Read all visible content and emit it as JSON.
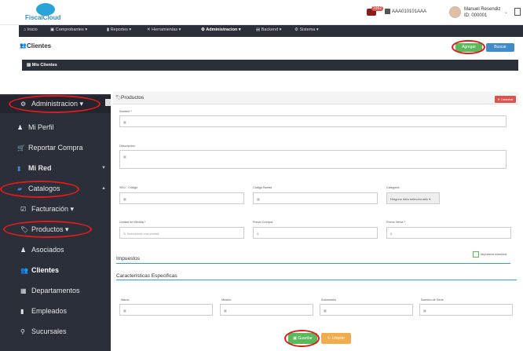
{
  "header": {
    "logo_text": "FiscalCloud",
    "notification_count": "1992",
    "company": "AAA010101AAA",
    "user_name": "Manuel Resendiz",
    "user_id": "ID: 000001"
  },
  "navbar": {
    "items": [
      {
        "label": "Inicio",
        "icon": "home-icon"
      },
      {
        "label": "Comprobantes",
        "icon": "file-icon"
      },
      {
        "label": "Reportes",
        "icon": "bar-chart-icon"
      },
      {
        "label": "Herramientas",
        "icon": "tools-icon"
      },
      {
        "label": "Administracion",
        "icon": "gears-icon",
        "active": true
      },
      {
        "label": "Backend",
        "icon": "server-icon"
      },
      {
        "label": "Sistema",
        "icon": "cog-icon"
      }
    ]
  },
  "clientes": {
    "title": "Clientes",
    "agregar_label": "Agregar",
    "buscar_label": "Buscar",
    "mis_clientes": "Mis Clientes"
  },
  "sidebar": {
    "items": [
      {
        "label": "Administracion",
        "icon": "gears-icon"
      },
      {
        "label": "Mi Perfil",
        "icon": "user-icon"
      },
      {
        "label": "Reportar Compra",
        "icon": "cart-icon"
      },
      {
        "label": "Mi Red",
        "icon": "network-icon"
      },
      {
        "label": "Catalogos",
        "icon": "book-icon"
      },
      {
        "label": "Facturación",
        "icon": "invoice-icon"
      },
      {
        "label": "Productos",
        "icon": "tag-icon"
      },
      {
        "label": "Asociados",
        "icon": "user-icon"
      },
      {
        "label": "Clientes",
        "icon": "users-icon"
      },
      {
        "label": "Departamentos",
        "icon": "building-icon"
      },
      {
        "label": "Empleados",
        "icon": "employee-icon"
      },
      {
        "label": "Sucursales",
        "icon": "location-icon"
      }
    ]
  },
  "productos": {
    "title": "Productos",
    "cancelar_label": "Cancelar",
    "fields": {
      "nombre": "Nombre *",
      "descripcion": "Descripción",
      "sku": "SKU - Código",
      "codigo_barras": "Código Barras",
      "categoria": "Categoria",
      "categoria_value": "Ninguno dato seleccionado",
      "unidad": "Unidad de Medida *",
      "unidad_placeholder": "Selecciona una unidad",
      "precio_compra": "Precio Compra",
      "precio_venta": "Precio Venta *",
      "currency": "$"
    },
    "impuestos_title": "Impuestos",
    "impuestos_incluidos": "Impuestos incluidos",
    "caracteristicas_title": "Caracteristicas Especificas",
    "char_fields": {
      "marca": "Marca",
      "modelo": "Modelo",
      "submodelo": "Submodelo",
      "numero_serie": "Numero de Serie"
    },
    "guardar_label": "Guardar",
    "limpiar_label": "Limpiar"
  },
  "colors": {
    "accent": "#2aa3d8",
    "navbar": "#2b2f3a",
    "success": "#5cb85c",
    "danger": "#d9534f",
    "warning": "#f0ad4e",
    "highlight": "#e11b1b"
  }
}
